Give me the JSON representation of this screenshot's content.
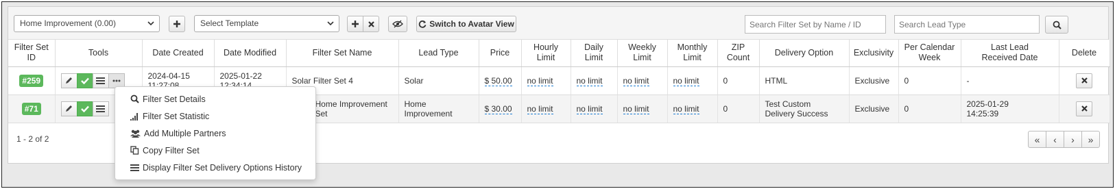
{
  "toolbar": {
    "campaign_select": "Home Improvement (0.00)",
    "template_select_placeholder": "Select Template",
    "avatar_button": "Switch to Avatar View",
    "search_filter_placeholder": "Search Filter Set by Name / ID",
    "search_lead_placeholder": "Search Lead Type"
  },
  "table": {
    "headers": {
      "id_line1": "Filter Set",
      "id_line2": "ID",
      "tools": "Tools",
      "date_created": "Date Created",
      "date_modified": "Date Modified",
      "name": "Filter Set Name",
      "lead_type": "Lead Type",
      "price": "Price",
      "hourly_line1": "Hourly",
      "hourly_line2": "Limit",
      "daily_line1": "Daily",
      "daily_line2": "Limit",
      "weekly_line1": "Weekly",
      "weekly_line2": "Limit",
      "monthly_line1": "Monthly",
      "monthly_line2": "Limit",
      "zip_line1": "ZIP",
      "zip_line2": "Count",
      "delivery": "Delivery Option",
      "exclusivity": "Exclusivity",
      "per_week_line1": "Per Calendar",
      "per_week_line2": "Week",
      "last_lead_line1": "Last Lead",
      "last_lead_line2": "Received Date",
      "delete": "Delete"
    },
    "rows": [
      {
        "id": "#259",
        "created_date": "2024-04-15",
        "created_time": "11:27:08",
        "modified_date": "2025-01-22",
        "modified_time": "12:34:14",
        "name": "Solar Filter Set 4",
        "lead_type_line1": "Solar",
        "lead_type_line2": "",
        "price": "$ 50.00",
        "hourly": "no limit",
        "daily": "no limit",
        "weekly": "no limit",
        "monthly": "no limit",
        "zip_count": "0",
        "delivery_line1": "HTML",
        "delivery_line2": "",
        "exclusivity": "Exclusive",
        "per_week": "0",
        "last_lead_line1": "-",
        "last_lead_line2": ""
      },
      {
        "id": "#71",
        "created_date": "",
        "created_time": "",
        "modified_date": "",
        "modified_time": "",
        "name_line1": "Home Improvement",
        "name_line2": "Set",
        "lead_type_line1": "Home",
        "lead_type_line2": "Improvement",
        "price": "$ 30.00",
        "hourly": "no limit",
        "daily": "no limit",
        "weekly": "no limit",
        "monthly": "no limit",
        "zip_count": "0",
        "delivery_line1": "Test Custom",
        "delivery_line2": "Delivery Success",
        "exclusivity": "Exclusive",
        "per_week": "0",
        "last_lead_line1": "2025-01-29",
        "last_lead_line2": "14:25:39"
      }
    ]
  },
  "pagination": {
    "summary": "1 - 2 of 2"
  },
  "dropdown_menu": {
    "items": [
      {
        "label": "Filter Set Details",
        "icon": "search-icon"
      },
      {
        "label": "Filter Set Statistic",
        "icon": "bar-chart-icon"
      },
      {
        "label": "Add Multiple Partners",
        "icon": "users-icon"
      },
      {
        "label": "Copy Filter Set",
        "icon": "copy-icon"
      },
      {
        "label": "Display Filter Set Delivery Options History",
        "icon": "list-icon"
      }
    ]
  },
  "colors": {
    "accent_green": "#5cb85c",
    "link_dash": "#1a7bd1"
  }
}
